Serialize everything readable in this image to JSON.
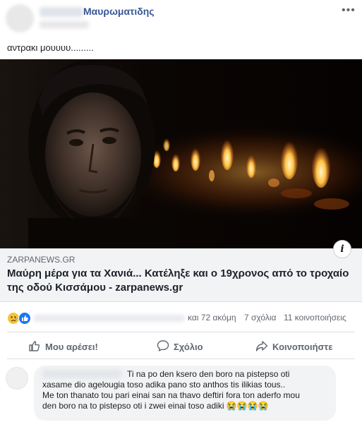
{
  "post": {
    "author_name": "Μαυρωματιδης",
    "text": "αντρακι μουυυυ.........",
    "more_icon": "more-options-icon"
  },
  "link_preview": {
    "domain": "ZARPANEWS.GR",
    "title": "Μαύρη μέρα για τα Χανιά... Κατέληξε και ο 19χρονος από το τροχαίο της οδού Κισσάμου - zarpanews.gr",
    "info_glyph": "i"
  },
  "reactions": {
    "others": "και 72 ακόμη",
    "comments": "7 σχόλια",
    "shares": "11 κοινοποιήσεις",
    "icons": [
      "sad-reaction-icon",
      "like-reaction-icon"
    ]
  },
  "actions": {
    "like": "Μου αρέσει!",
    "comment": "Σχόλιο",
    "share": "Κοινοποιήστε"
  },
  "comment": {
    "text": "Ti na po den ksero den boro na pistepso oti\nxasame dio agelougia toso adika pano sto anthos tis ilikias tous..\nMe ton thanato tou pari einai san na thavo deftiri fora ton aderfo mou\nden boro na to pistepso oti i zwei einai toso adiki 😭😭😭😭"
  },
  "colors": {
    "link_blue": "#385898",
    "facebook_blue": "#1877f2",
    "card_grey": "#f2f3f5"
  }
}
